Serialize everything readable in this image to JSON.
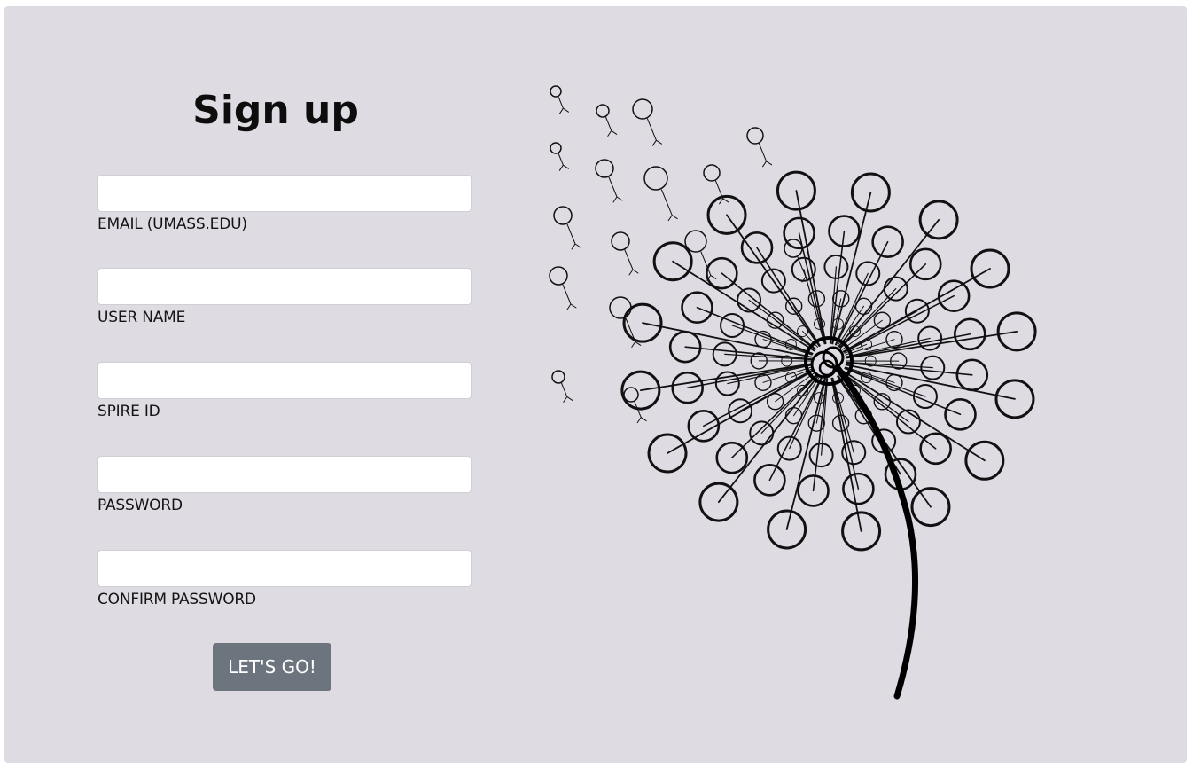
{
  "form": {
    "title": "Sign up",
    "fields": [
      {
        "label": "EMAIL (UMASS.EDU)",
        "value": "",
        "type": "email"
      },
      {
        "label": "USER NAME",
        "value": "",
        "type": "text"
      },
      {
        "label": "SPIRE ID",
        "value": "",
        "type": "text"
      },
      {
        "label": "PASSWORD",
        "value": "",
        "type": "password"
      },
      {
        "label": "CONFIRM PASSWORD",
        "value": "",
        "type": "password"
      }
    ],
    "submit_label": "LET'S GO!"
  },
  "illustration": {
    "icon": "dandelion-illustration"
  },
  "colors": {
    "background": "#dedbe2",
    "button": "#6c757d",
    "button_text": "#ffffff"
  }
}
